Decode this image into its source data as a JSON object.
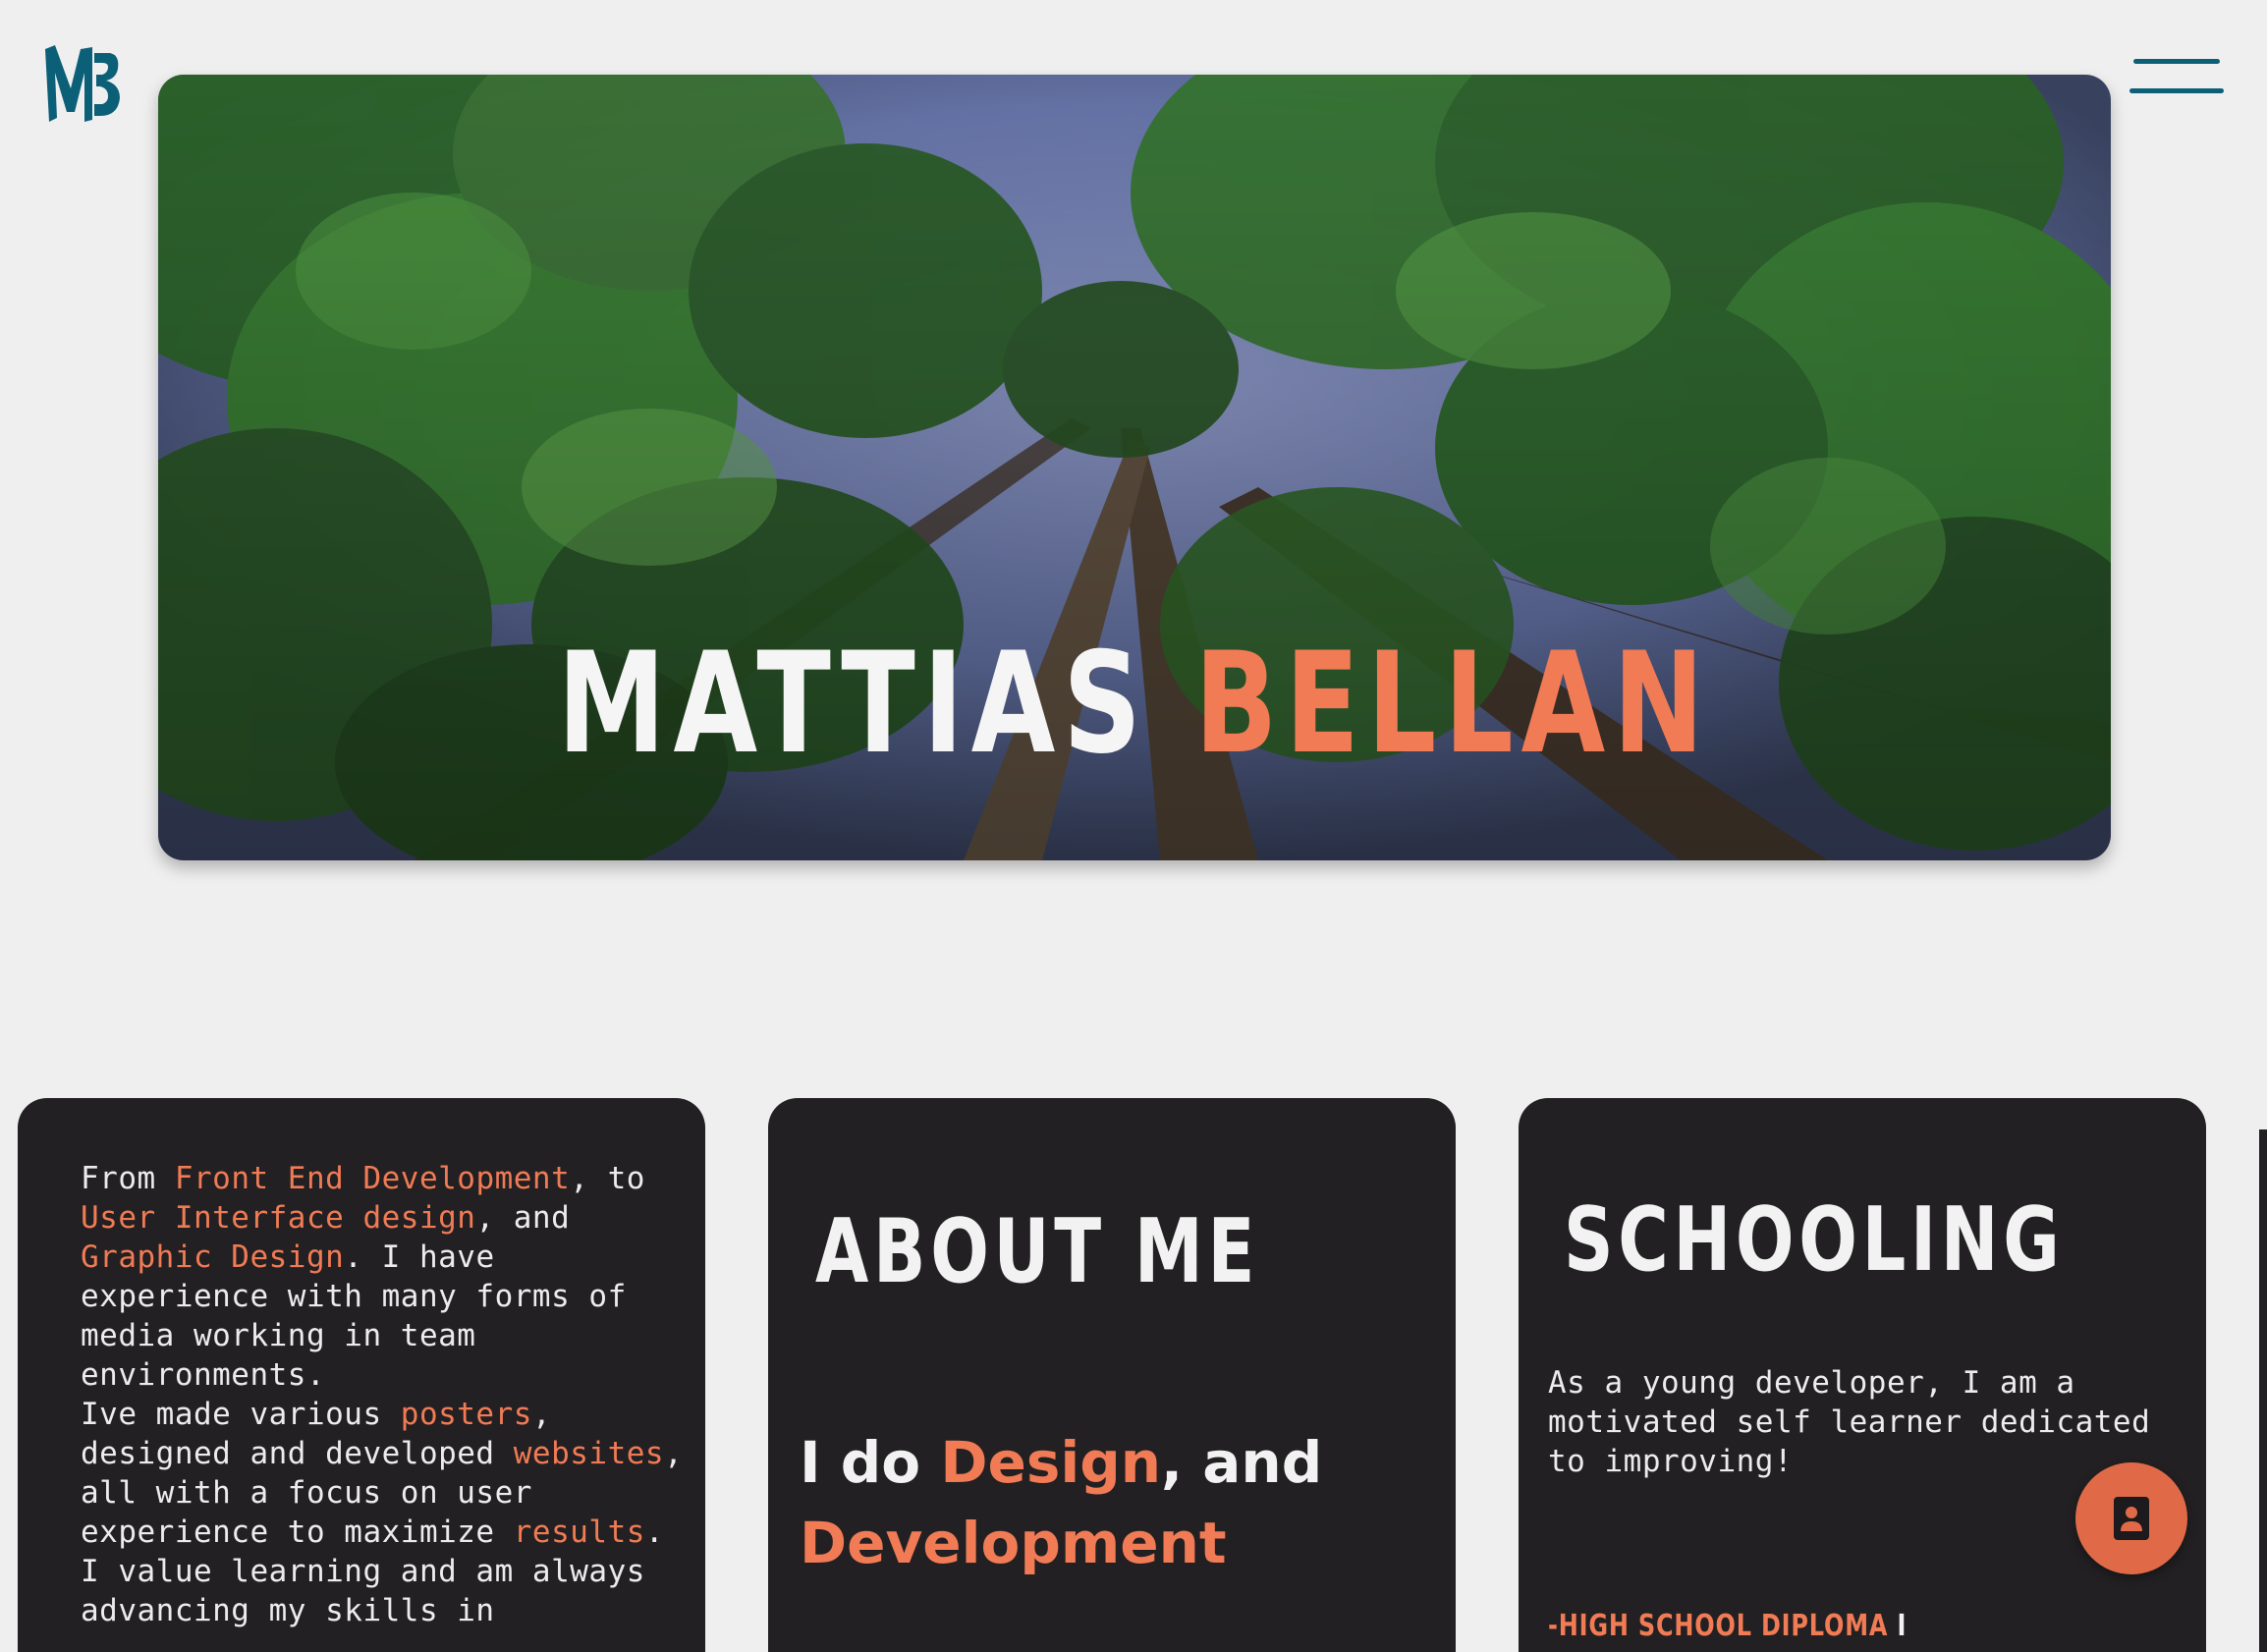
{
  "logo": {
    "icon": "mb-monogram-logo",
    "color": "#0b5f77"
  },
  "nav": {
    "menu_icon": "hamburger-icon",
    "color": "#0b5f77"
  },
  "hero": {
    "background": "forest-canopy-photo",
    "first_name": "MATTIAS",
    "last_name": "BELLAN"
  },
  "colors": {
    "page_bg": "#efefef",
    "card_bg": "#222022",
    "accent": "#f07b55",
    "brand": "#0b5f77",
    "text_light": "#f2f2f2"
  },
  "cards": {
    "intro": {
      "p1_a": "From ",
      "p1_hl1": "Front End Development",
      "p1_b": ", to ",
      "p1_hl2": "User Interface design",
      "p1_c": ", and ",
      "p1_hl3": "Graphic Design",
      "p1_d": ". I have experience with many forms of media working in team environments.",
      "p2_a": "Ive made various ",
      "p2_hl1": "posters",
      "p2_b": ", designed and developed ",
      "p2_hl2": "websites",
      "p2_c": ", all with a focus on user experience to maximize ",
      "p2_hl3": "results",
      "p2_d": ".",
      "p3": "I value learning and am always advancing my skills in"
    },
    "about": {
      "heading": "ABOUT ME",
      "tag_a": "I do ",
      "tag_hl1": "Design",
      "tag_b": ", and ",
      "tag_hl2": "Development"
    },
    "schooling": {
      "heading": "SCHOOLING",
      "text": "As a young developer, I am a motivated self learner dedicated to improving!",
      "diploma": "-HIGH SCHOOL DIPLOMA",
      "diploma_sep": "I"
    }
  },
  "fab": {
    "icon": "contact-card-icon",
    "color": "#e06a48"
  }
}
